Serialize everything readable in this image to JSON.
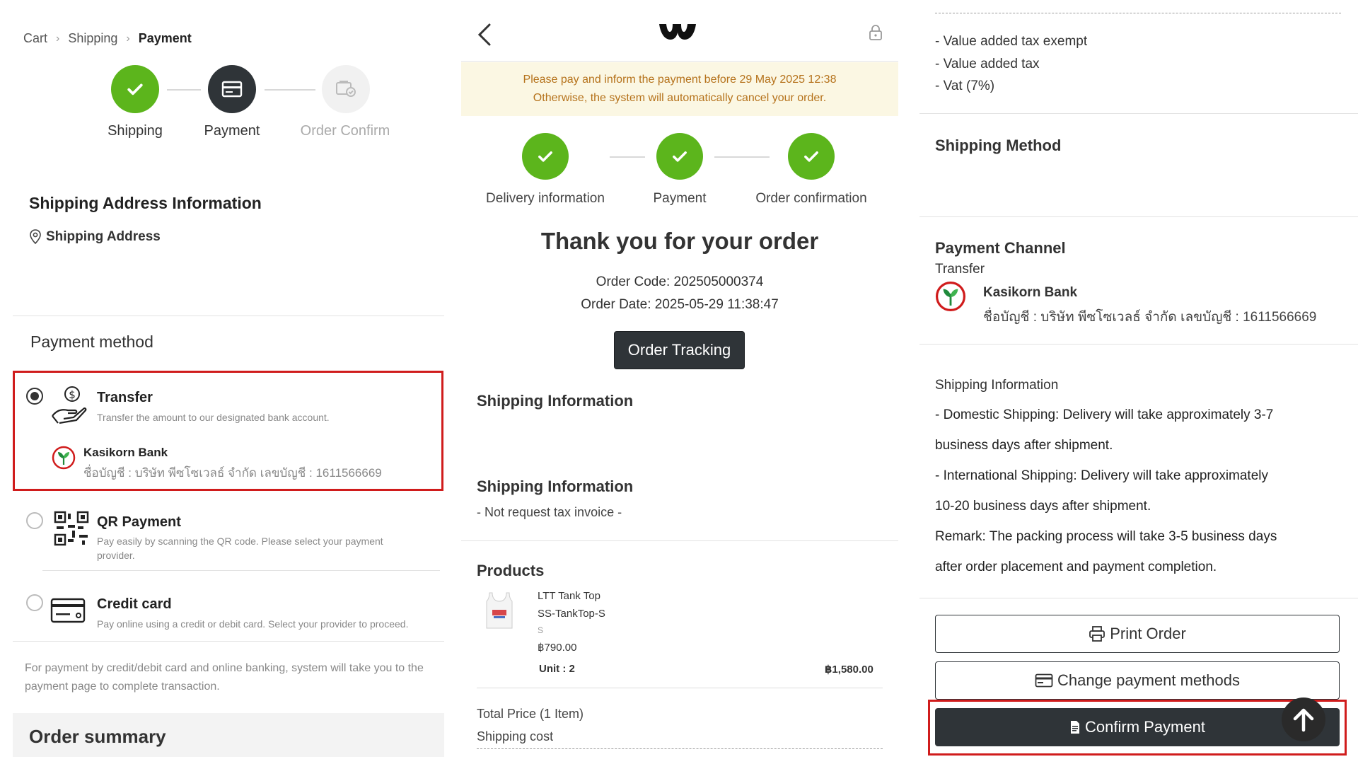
{
  "left": {
    "breadcrumb": {
      "cart": "Cart",
      "shipping": "Shipping",
      "payment": "Payment",
      "sep": ">"
    },
    "steps": {
      "shipping": "Shipping",
      "payment": "Payment",
      "confirm": "Order Confirm"
    },
    "shipping_address_title": "Shipping Address Information",
    "shipping_address_label": "Shipping Address",
    "payment_method_title": "Payment method",
    "options": {
      "transfer": {
        "title": "Transfer",
        "desc": "Transfer the amount to our designated bank account."
      },
      "bank": {
        "name": "Kasikorn Bank",
        "account": "ชื่อบัญชี : บริษัท พีซโซเวลธ์ จำกัด เลขบัญชี : 1611566669"
      },
      "qr": {
        "title": "QR Payment",
        "desc": "Pay easily by scanning the QR code. Please select your payment provider."
      },
      "credit": {
        "title": "Credit card",
        "desc": "Pay online using a credit or debit card. Select your provider to proceed."
      }
    },
    "note": "For payment by credit/debit card and online banking, system will take you to the payment page to complete transaction.",
    "order_summary": "Order summary"
  },
  "middle": {
    "warning_line1": "Please pay and inform the payment before 29 May 2025 12:38",
    "warning_line2": "Otherwise, the system will automatically cancel your order.",
    "steps": {
      "delivery": "Delivery information",
      "payment": "Payment",
      "confirmation": "Order confirmation"
    },
    "thanks": "Thank you for your order",
    "order_code": "Order Code: 202505000374",
    "order_date": "Order Date: 2025-05-29 11:38:47",
    "tracking_button": "Order Tracking",
    "shipping_info_title_1": "Shipping Information",
    "shipping_info_title_2": "Shipping Information",
    "tax_invoice": "- Not request tax invoice -",
    "products_title": "Products",
    "product": {
      "name": "LTT Tank Top",
      "sku": "SS-TankTop-S",
      "size": "S",
      "price": "฿790.00",
      "unit": "Unit : 2",
      "total": "฿1,580.00"
    },
    "total_price": "Total Price (1 Item)",
    "shipping_cost": "Shipping cost"
  },
  "right": {
    "vat_exempt": "- Value added tax exempt",
    "vat": "- Value added tax",
    "vat7": "- Vat (7%)",
    "shipping_method_title": "Shipping Method",
    "payment_channel_title": "Payment Channel",
    "payment_channel_value": "Transfer",
    "bank_name": "Kasikorn Bank",
    "bank_account": "ชื่อบัญชี : บริษัท พีซโซเวลธ์ จำกัด เลขบัญชี : 1611566669",
    "shipping_info_title": "Shipping Information",
    "shipping_lines": [
      "- Domestic Shipping: Delivery will take approximately 3-7",
      "business days after shipment.",
      "- International Shipping: Delivery will take approximately",
      "10-20 business days after shipment.",
      "Remark: The packing process will take 3-5 business days",
      "after order placement and payment completion."
    ],
    "print_button": "Print Order",
    "change_button": "Change payment methods",
    "confirm_button": "Confirm Payment"
  },
  "colors": {
    "green": "#5cb51c",
    "dark": "#2f3438",
    "highlight_red": "#d01c1c",
    "warning_bg": "#fbf7e3",
    "warning_text": "#b5721b"
  },
  "icons": [
    "check-icon",
    "credit-card-icon",
    "order-confirm-icon",
    "map-pin-icon",
    "money-hand-icon",
    "kbank-logo-icon",
    "qr-code-icon",
    "card-icon",
    "back-arrow-icon",
    "lock-icon",
    "printer-icon",
    "document-icon",
    "arrow-up-icon"
  ]
}
